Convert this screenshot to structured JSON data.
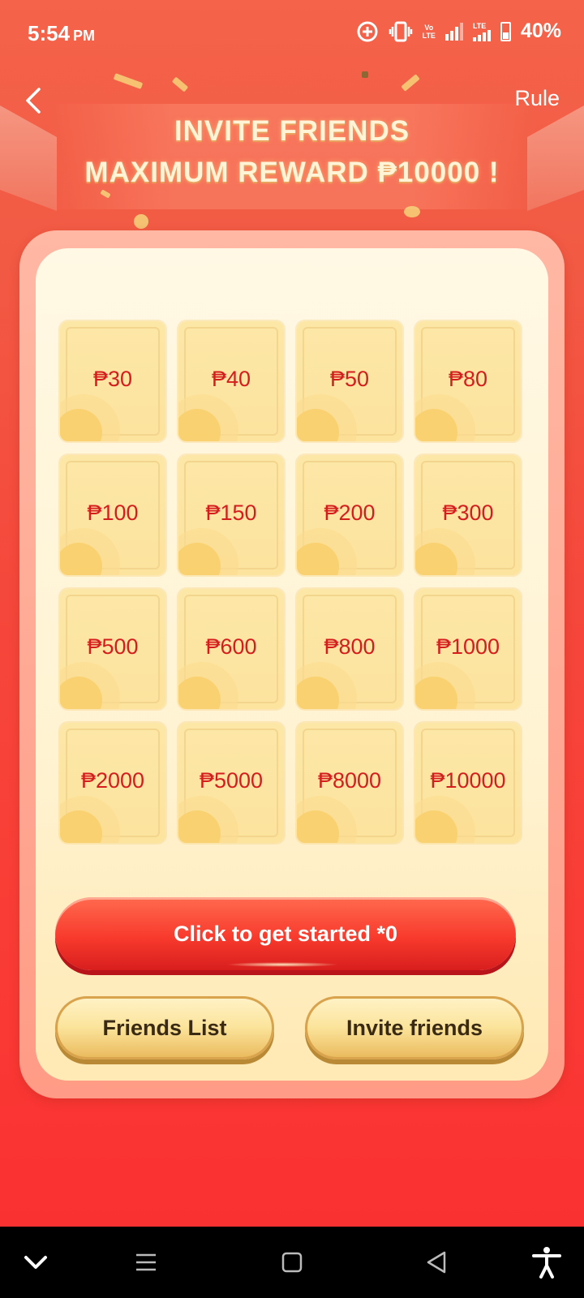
{
  "status_bar": {
    "time": "5:54",
    "ampm": "PM",
    "network_label_top": "Vo",
    "network_label_bottom": "LTE",
    "lte_label": "LTE",
    "battery_percent": "40%",
    "battery_level": 0.4,
    "icons": [
      "data-saver-icon",
      "vibrate-icon",
      "volte-icon",
      "signal-icon",
      "signal-icon",
      "battery-charging-icon"
    ]
  },
  "header": {
    "back_icon": "chevron-left-icon",
    "rule_label": "Rule",
    "title_line1": "INVITE FRIENDS",
    "title_line2": "MAXIMUM REWARD ₱10000 !"
  },
  "rewards": [
    "₱30",
    "₱40",
    "₱50",
    "₱80",
    "₱100",
    "₱150",
    "₱200",
    "₱300",
    "₱500",
    "₱600",
    "₱800",
    "₱1000",
    "₱2000",
    "₱5000",
    "₱8000",
    "₱10000"
  ],
  "actions": {
    "start_label": "Click to get started *0",
    "friends_list_label": "Friends List",
    "invite_label": "Invite friends"
  },
  "navigation_bar": {
    "icons": [
      "chevron-down-icon",
      "menu-icon",
      "home-square-icon",
      "back-triangle-icon",
      "accessibility-icon"
    ]
  },
  "colors": {
    "accent_red": "#f83a2d",
    "reward_text": "#d51d1d",
    "gold": "#fbe39a"
  }
}
